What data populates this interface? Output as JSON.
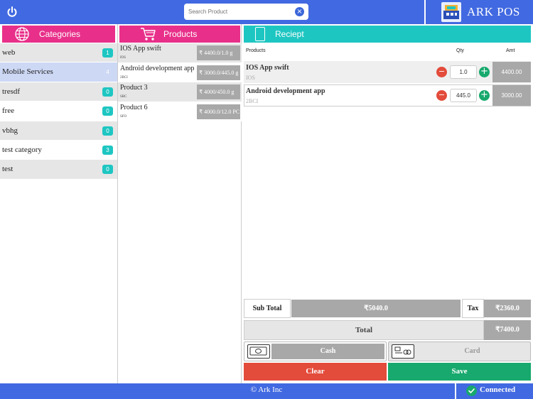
{
  "header": {
    "search_placeholder": "Search Product",
    "brand_name": "ARK POS"
  },
  "categories": {
    "title": "Categories",
    "items": [
      {
        "label": "web",
        "count": "1"
      },
      {
        "label": "Mobile Services",
        "count": "4"
      },
      {
        "label": "tresdf",
        "count": "0"
      },
      {
        "label": "free",
        "count": "0"
      },
      {
        "label": "vbhg",
        "count": "0"
      },
      {
        "label": "test category",
        "count": "3"
      },
      {
        "label": "test",
        "count": "0"
      }
    ],
    "selected": "Mobile Services"
  },
  "products": {
    "title": "Products",
    "items": [
      {
        "name": "IOS App swift",
        "code": "IOS",
        "price": "₹ 4400.0/1.0 g"
      },
      {
        "name": "Android development app",
        "code": "2BCI",
        "price": "₹ 3000.0/445.0 g"
      },
      {
        "name": "Product 3",
        "code": "SBC",
        "price": "₹ 4000/450.0 g"
      },
      {
        "name": "Product 6",
        "code": "SFO",
        "price": "₹ 4000.0/12.0 PC"
      }
    ]
  },
  "receipt": {
    "title": "Reciept",
    "col_products": "Products",
    "col_qty": "Qty",
    "col_amt": "Amt",
    "rows": [
      {
        "name": "IOS App swift",
        "code": "IOS",
        "qty": "1.0",
        "amt": "4400.00"
      },
      {
        "name": "Android development app",
        "code": "2BCI",
        "qty": "445.0",
        "amt": "3000.00"
      }
    ],
    "sub_total_label": "Sub Total",
    "sub_total_value": "₹5040.0",
    "tax_label": "Tax",
    "tax_value": "₹2360.0",
    "total_label": "Total",
    "total_value": "₹7400.0",
    "cash_label": "Cash",
    "card_label": "Card",
    "clear_label": "Clear",
    "save_label": "Save"
  },
  "footer": {
    "copyright": "© Ark Inc",
    "status": "Connected"
  },
  "colors": {
    "topbar": "#4169e1",
    "category_header": "#e8308a",
    "receipt_header": "#1ec6c2",
    "clear": "#e34b3b",
    "save": "#17a96d"
  }
}
